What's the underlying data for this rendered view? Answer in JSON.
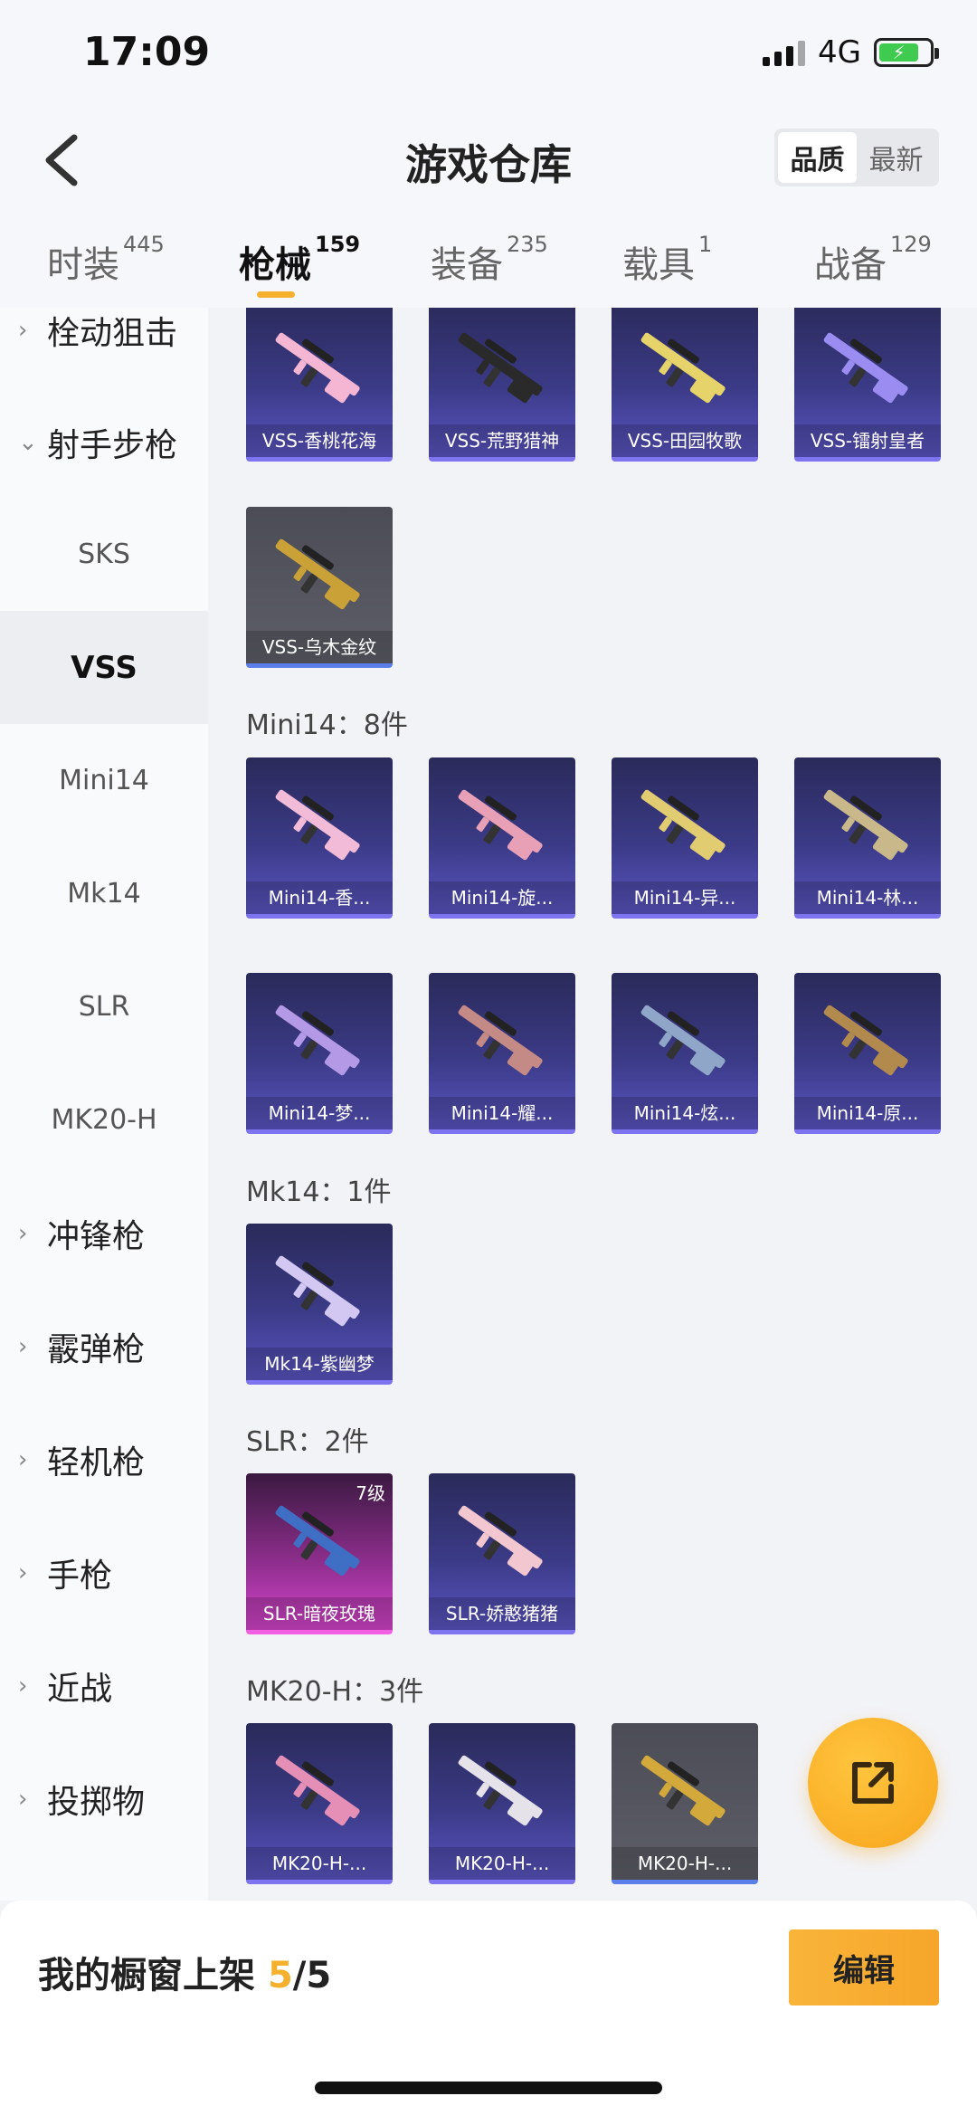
{
  "status": {
    "time": "17:09",
    "network": "4G",
    "battery_level": 0.8
  },
  "header": {
    "title": "游戏仓库",
    "sort_options": [
      "品质",
      "最新"
    ]
  },
  "tabs": [
    {
      "label": "时装",
      "count": "445"
    },
    {
      "label": "枪械",
      "count": "159"
    },
    {
      "label": "装备",
      "count": "235"
    },
    {
      "label": "载具",
      "count": "1"
    },
    {
      "label": "战备",
      "count": "129"
    }
  ],
  "sidebar": {
    "items": [
      {
        "label": "栓动狙击"
      },
      {
        "label": "射手步枪"
      },
      {
        "label": "SKS"
      },
      {
        "label": "VSS"
      },
      {
        "label": "Mini14"
      },
      {
        "label": "Mk14"
      },
      {
        "label": "SLR"
      },
      {
        "label": "MK20-H"
      },
      {
        "label": "冲锋枪"
      },
      {
        "label": "霰弹枪"
      },
      {
        "label": "轻机枪"
      },
      {
        "label": "手枪"
      },
      {
        "label": "近战"
      },
      {
        "label": "投掷物"
      }
    ]
  },
  "sections": {
    "vss": {
      "items": [
        {
          "name": "VSS-香桃花海",
          "color": "#f4b6d2"
        },
        {
          "name": "VSS-荒野猎神",
          "color": "#2a2a2a"
        },
        {
          "name": "VSS-田园牧歌",
          "color": "#e6d46a"
        },
        {
          "name": "VSS-镭射皇者",
          "color": "#9a8cf0"
        },
        {
          "name": "VSS-乌木金纹",
          "color": "#c9a136"
        }
      ]
    },
    "mini14": {
      "title": "Mini14：8件",
      "items": [
        {
          "name": "Mini14-香...",
          "color": "#f2bcd8"
        },
        {
          "name": "Mini14-旋...",
          "color": "#e8a0b6"
        },
        {
          "name": "Mini14-异...",
          "color": "#e2cc72"
        },
        {
          "name": "Mini14-林...",
          "color": "#c9b98a"
        },
        {
          "name": "Mini14-梦...",
          "color": "#b49ae6"
        },
        {
          "name": "Mini14-耀...",
          "color": "#c48a86"
        },
        {
          "name": "Mini14-炫...",
          "color": "#8fa6c8"
        },
        {
          "name": "Mini14-原...",
          "color": "#b38a4e"
        }
      ]
    },
    "mk14": {
      "title": "Mk14：1件",
      "items": [
        {
          "name": "Mk14-紫幽梦",
          "color": "#d2c8f2"
        }
      ]
    },
    "slr": {
      "title": "SLR：2件",
      "items": [
        {
          "name": "SLR-暗夜玫瑰",
          "color": "#3f6fc4",
          "level": "7级"
        },
        {
          "name": "SLR-娇憨猪猪",
          "color": "#f3c7cf"
        }
      ]
    },
    "mk20h": {
      "title": "MK20-H：3件",
      "items": [
        {
          "name": "MK20-H-...",
          "color": "#e58fb7"
        },
        {
          "name": "MK20-H-...",
          "color": "#e6e2ea"
        },
        {
          "name": "MK20-H-...",
          "color": "#d2a93a"
        }
      ]
    }
  },
  "bottom_bar": {
    "label": "我的橱窗上架",
    "count": "5",
    "total": "/5",
    "edit_label": "编辑"
  },
  "colors": {
    "accent": "#f5b02e",
    "card_purple": "#3b3a86",
    "card_pink": "#d545cc"
  }
}
